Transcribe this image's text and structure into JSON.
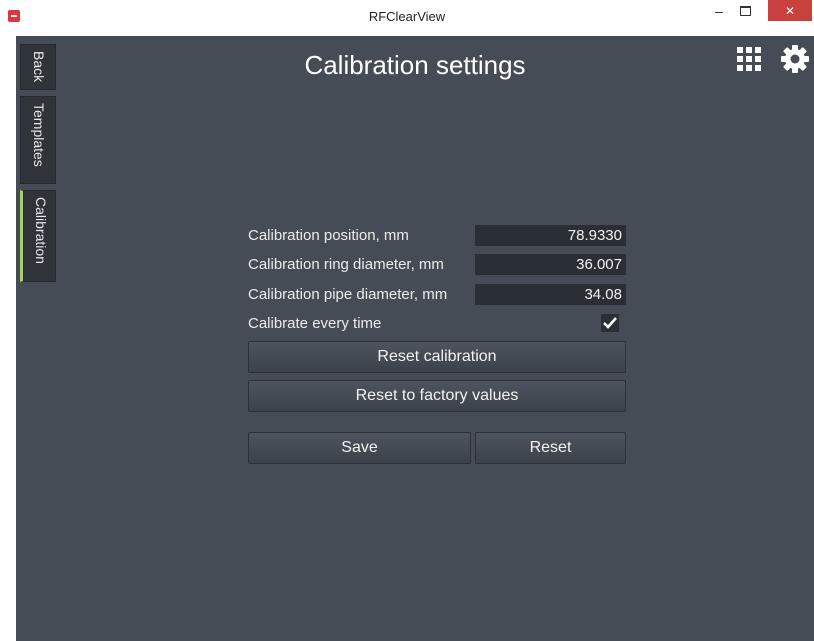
{
  "window": {
    "title": "RFClearView",
    "min_glyph": "–",
    "close_glyph": "✕"
  },
  "sidebar": {
    "tabs": [
      {
        "label": "Back",
        "active": false
      },
      {
        "label": "Templates",
        "active": false
      },
      {
        "label": "Calibration",
        "active": true
      }
    ]
  },
  "header": {
    "title": "Calibration settings",
    "icons": [
      "grid-icon",
      "gear-icon"
    ]
  },
  "form": {
    "calibration_position": {
      "label": "Calibration position, mm",
      "value": "78.9330"
    },
    "ring_diameter": {
      "label": "Calibration ring diameter, mm",
      "value": "36.007"
    },
    "pipe_diameter": {
      "label": "Calibration pipe diameter, mm",
      "value": "34.08"
    },
    "calibrate_every_time": {
      "label": "Calibrate every time",
      "checked": true
    }
  },
  "buttons": {
    "reset_calibration": "Reset calibration",
    "reset_factory": "Reset to factory values",
    "save": "Save",
    "reset": "Reset"
  },
  "colors": {
    "background": "#454c55",
    "active_tab_accent": "#a8d255",
    "close_button": "#c7423f"
  }
}
